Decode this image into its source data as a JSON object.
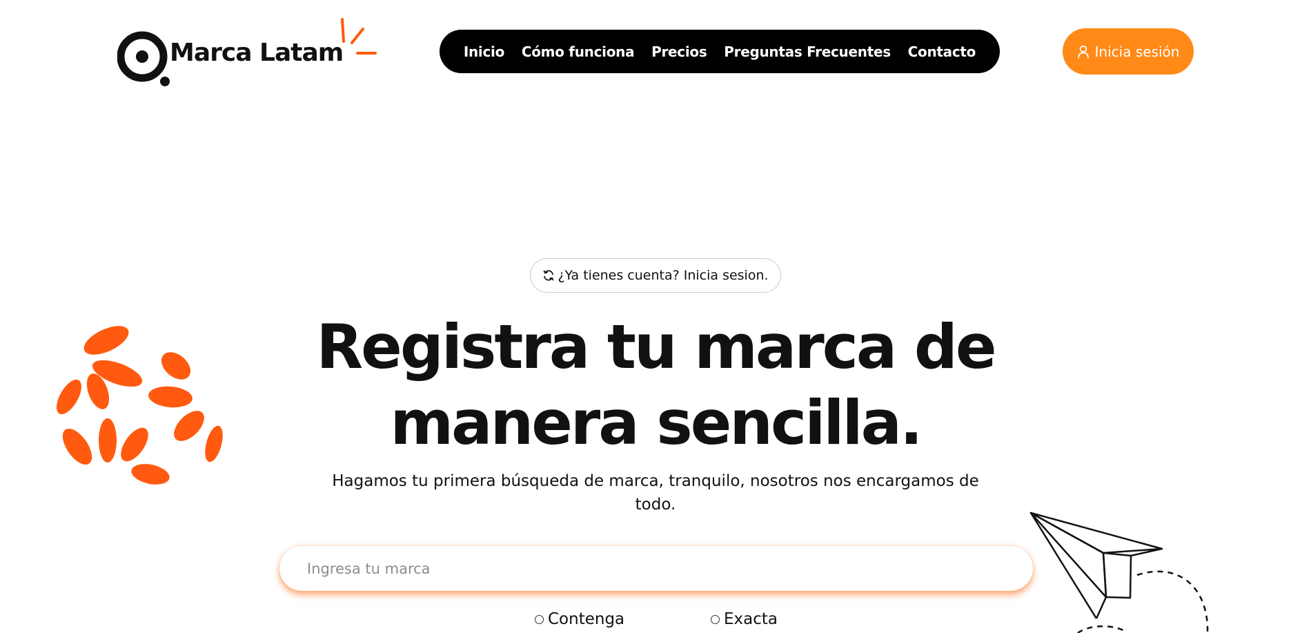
{
  "brand": {
    "name": "Marca Latam",
    "accent_color": "#ff8a18",
    "petal_color": "#ff5a0f"
  },
  "nav": {
    "items": [
      {
        "label": "Inicio"
      },
      {
        "label": "Cómo funciona"
      },
      {
        "label": "Precios"
      },
      {
        "label": "Preguntas Frecuentes"
      },
      {
        "label": "Contacto"
      }
    ]
  },
  "header": {
    "login_label": "Inicia sesión",
    "login_icon": "user-icon"
  },
  "hero": {
    "pill_icon": "refresh-icon",
    "pill_text": "¿Ya tienes cuenta? Inicia sesion.",
    "title_line1": "Registra tu marca de",
    "title_line2": "manera sencilla.",
    "subtitle_line1": "Hagamos tu primera búsqueda de marca, tranquilo, nosotros nos encargamos de",
    "subtitle_line2": "todo."
  },
  "search": {
    "placeholder": "Ingresa tu marca",
    "value": ""
  },
  "match_options": [
    {
      "label": "Contenga",
      "selected": false
    },
    {
      "label": "Exacta",
      "selected": false
    }
  ]
}
